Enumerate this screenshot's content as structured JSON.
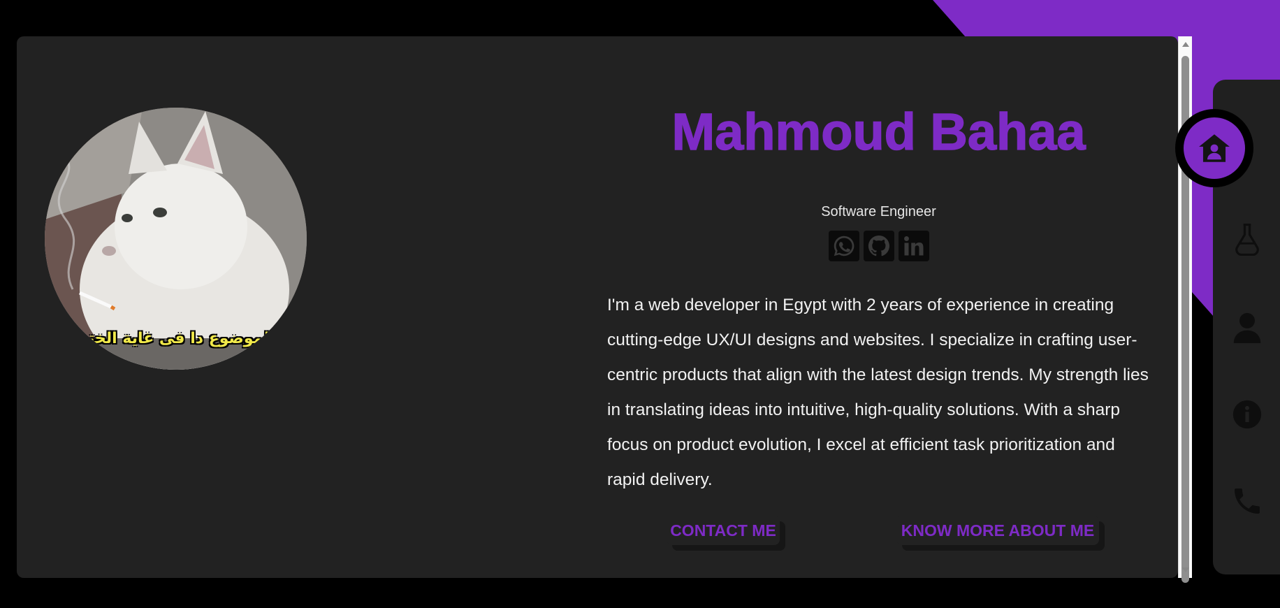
{
  "profile": {
    "name": "Mahmoud Bahaa",
    "role": "Software Engineer",
    "bio": "I'm a web developer in Egypt with 2 years of experience in creating cutting-edge UX/UI designs and websites. I specialize in crafting user-centric products that align with the latest design trends. My strength lies in translating ideas into intuitive, high-quality solutions. With a sharp focus on product evolution, I excel at efficient task prioritization and rapid delivery.",
    "avatar_caption": "الموضوع دا فى غاية الختم"
  },
  "socials": [
    {
      "icon": "whatsapp-icon"
    },
    {
      "icon": "github-icon"
    },
    {
      "icon": "linkedin-icon"
    }
  ],
  "actions": {
    "contact_label": "CONTACT ME",
    "more_label": "KNOW MORE ABOUT ME"
  },
  "nav": [
    {
      "icon": "home-icon",
      "active": true
    },
    {
      "icon": "flask-icon",
      "active": false
    },
    {
      "icon": "user-icon",
      "active": false
    },
    {
      "icon": "info-icon",
      "active": false
    },
    {
      "icon": "phone-icon",
      "active": false
    }
  ],
  "colors": {
    "accent": "#7e2bc6",
    "card": "#222222",
    "background": "#000000"
  }
}
